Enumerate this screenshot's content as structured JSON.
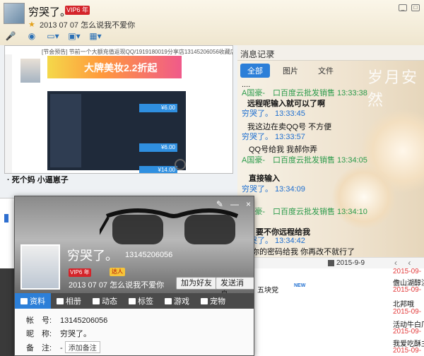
{
  "chat_header": {
    "name": "穷哭了。",
    "vip_badge": "VIP6 年",
    "signature": "2013 07 07 怎么说我不爱你"
  },
  "toolbar": {
    "items": [
      "microphone-icon",
      "video-icon",
      "folder-icon",
      "screen-share-icon",
      "apps-icon"
    ]
  },
  "screenshot_preview": {
    "banner_text": "大牌美妆2.2折起",
    "title_text": "[节会预告] 节前一个大额充值返现QQ/1919180019分享店13145206056收藏店铺"
  },
  "sent_message": "· 死个妈 小逼崽子",
  "history": {
    "title": "消息记录",
    "close": "×",
    "tabs": [
      "全部",
      "图片",
      "文件"
    ],
    "deco_text": "岁月安然",
    "rows": [
      {
        "kind": "text",
        "text": "...."
      },
      {
        "kind": "sender-g",
        "text": "A国豪-　口百度云批发销售 13:33:38"
      },
      {
        "kind": "text bold",
        "text": "远程呢输入就可以了啊"
      },
      {
        "kind": "sender-b",
        "text": "穷哭了。 13:33:45"
      },
      {
        "kind": "text",
        "text": "我这边在卖QQ号 不方便"
      },
      {
        "kind": "sender-b",
        "text": "穷哭了。 13:33:57"
      },
      {
        "kind": "text",
        "text": "QQ号给我 我郝你弄"
      },
      {
        "kind": "sender-g",
        "text": "A国豪-　口百度云批发销售 13:34:05"
      },
      {
        "kind": "text bold",
        "text": "直接输入"
      },
      {
        "kind": "sender-b",
        "text": "穷哭了。 13:34:09"
      },
      {
        "kind": "sender-g",
        "text": "A国豪-　口百度云批发销售 13:34:10"
      },
      {
        "kind": "text bold",
        "text": "要不你远程给我"
      },
      {
        "kind": "sender-b",
        "text": "穷哭了。 13:34:42"
      },
      {
        "kind": "text",
        "text": "日 你的密码给我 你再改不就行了"
      }
    ],
    "date": "2015-9-9"
  },
  "bg_list": [
    {
      "name": "五块党",
      "date": ""
    },
    {
      "name": "",
      "date": "2015-09-"
    },
    {
      "name": "儋山湖醇洪",
      "date": ""
    },
    {
      "name": "",
      "date": "2015-09-"
    },
    {
      "name": "北邦哦",
      "date": ""
    },
    {
      "name": "",
      "date": "2015-09-"
    },
    {
      "name": "活动牛白厂",
      "date": ""
    },
    {
      "name": "",
      "date": "2015-09-"
    },
    {
      "name": "我爱吃酥主",
      "date": ""
    },
    {
      "name": "",
      "date": "2015-09-"
    }
  ],
  "bg_new": "NEW",
  "profile_card": {
    "name": "穷哭了。",
    "uid": "13145206056",
    "vip_badge": "VIP6 年",
    "badge2": "达人",
    "signature": "2013 07 07 怎么说我不爱你",
    "add_friend": "加为好友",
    "send_message": "发送消息",
    "window_buttons": [
      "✎",
      "—",
      "×"
    ],
    "tabs": [
      "资料",
      "相册",
      "动态",
      "标签",
      "游戏",
      "宠物"
    ],
    "info": {
      "account_label": "帐　号:",
      "account_value": "13145206056",
      "nick_label": "昵　称:",
      "nick_value": "穷哭了。",
      "note_label": "备　注:",
      "note_value": "-",
      "add_note": "添加备注"
    }
  }
}
